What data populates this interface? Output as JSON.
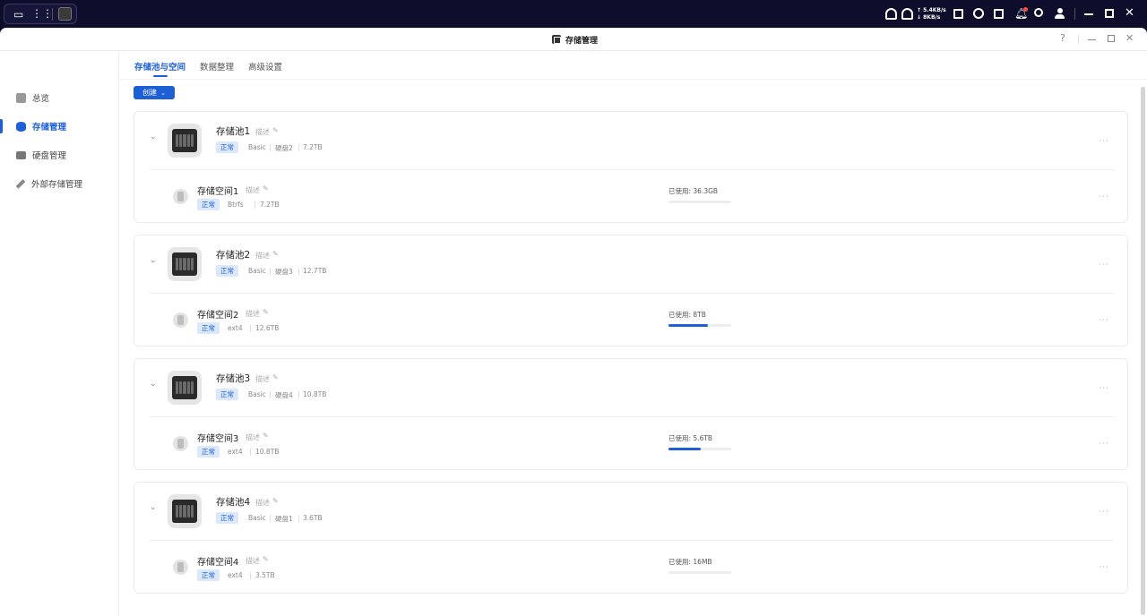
{
  "sysbar": {
    "upload_speed": "↑ 5.4KB/s",
    "download_speed": "↓ 8KB/s"
  },
  "window": {
    "title": "存储管理",
    "help": "?"
  },
  "sidebar": {
    "items": [
      {
        "label": "总览",
        "icon": "overview-icon",
        "active": false
      },
      {
        "label": "存储管理",
        "icon": "storage-icon",
        "active": true
      },
      {
        "label": "硬盘管理",
        "icon": "disk-icon",
        "active": false
      },
      {
        "label": "外部存储管理",
        "icon": "external-storage-icon",
        "active": false
      }
    ]
  },
  "tabs": [
    {
      "label": "存储池与空间",
      "active": true
    },
    {
      "label": "数据整理",
      "active": false
    },
    {
      "label": "高级设置",
      "active": false
    }
  ],
  "create_button": "创建",
  "desc_label": "描述",
  "used_prefix": "已使用: ",
  "pools": [
    {
      "name": "存储池1",
      "status": "正常",
      "raid": "Basic",
      "disks": "硬盘2",
      "size": "7.2TB",
      "volume": {
        "name": "存储空间1",
        "status": "正常",
        "fs": "Btrfs",
        "size": "7.2TB",
        "used": "36.3GB",
        "used_fraction": 0.005
      }
    },
    {
      "name": "存储池2",
      "status": "正常",
      "raid": "Basic",
      "disks": "硬盘3",
      "size": "12.7TB",
      "volume": {
        "name": "存储空间2",
        "status": "正常",
        "fs": "ext4",
        "size": "12.6TB",
        "used": "8TB",
        "used_fraction": 0.635
      }
    },
    {
      "name": "存储池3",
      "status": "正常",
      "raid": "Basic",
      "disks": "硬盘4",
      "size": "10.8TB",
      "volume": {
        "name": "存储空间3",
        "status": "正常",
        "fs": "ext4",
        "size": "10.8TB",
        "used": "5.6TB",
        "used_fraction": 0.519
      }
    },
    {
      "name": "存储池4",
      "status": "正常",
      "raid": "Basic",
      "disks": "硬盘1",
      "size": "3.6TB",
      "volume": {
        "name": "存储空间4",
        "status": "正常",
        "fs": "ext4",
        "size": "3.5TB",
        "used": "16MB",
        "used_fraction": 0.0
      }
    }
  ],
  "colors": {
    "accent": "#1d5fd6",
    "badge_bg": "#dbe7fb",
    "topbar": "#0e0e2c"
  }
}
